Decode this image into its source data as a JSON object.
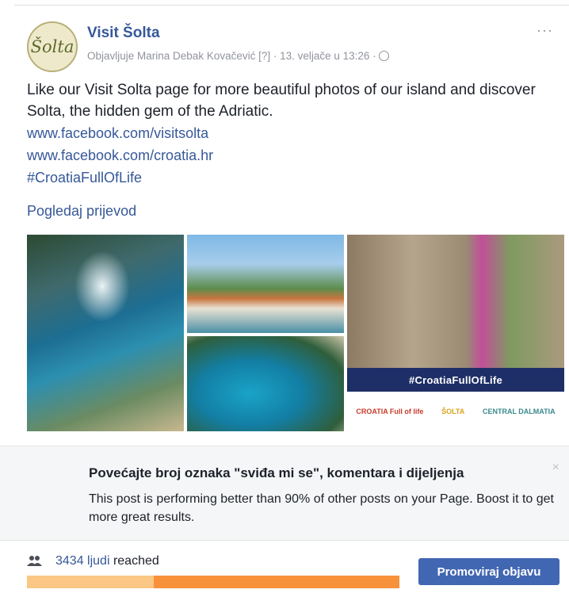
{
  "post": {
    "avatar_text": "Šolta",
    "page_name": "Visit Šolta",
    "meta": "Objavljuje Marina Debak Kovačević [?] · 13. veljače u 13:26 ·",
    "more": "···",
    "text": "Like our Visit Solta page for more beautiful photos of our island and discover Solta, the hidden gem of the Adriatic.",
    "links": [
      "www.facebook.com/visitsolta",
      "www.facebook.com/croatia.hr",
      "#CroatiaFullOfLife"
    ],
    "translate": "Pogledaj prijevod"
  },
  "photos": {
    "banner": "#CroatiaFullOfLife",
    "logos": [
      "CROATIA Full of life",
      "ŠOLTA",
      "CENTRAL DALMATIA"
    ]
  },
  "boost": {
    "title": "Povećajte broj oznaka \"sviđa mi se\", komentara i dijeljenja",
    "body": "This post is performing better than 90% of other posts on your Page. Boost it to get more great results.",
    "close": "×"
  },
  "reach": {
    "count": "3434 ljudi",
    "suffix": " reached",
    "organic_share": 0.34,
    "button": "Promoviraj objavu"
  },
  "colors": {
    "link": "#365899",
    "button": "#4267b2",
    "bar_light": "#fbc784",
    "bar_dark": "#f7923a"
  }
}
